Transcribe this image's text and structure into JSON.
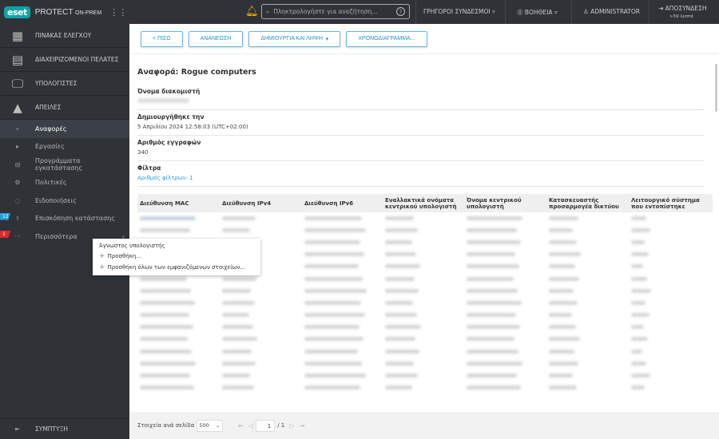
{
  "header": {
    "logo": "eset",
    "product": "PROTECT",
    "product_suffix": "ON-PREM",
    "search_placeholder": "Πληκτρολογήστε για αναζήτηση...",
    "quick_links": "ΓΡΗΓΟΡΟΙ ΣΥΝΔΕΣΜΟΙ",
    "help": "ΒΟΗΘΕΙΑ",
    "user": "ADMINISTRATOR",
    "logout": "ΑΠΟΣΥΝΔΕΣΗ",
    "logout_time": ">59 λεπτά"
  },
  "sidebar": {
    "main_items": [
      {
        "label": "ΠΙΝΑΚΑΣ ΕΛΕΓΧΟΥ",
        "icon": "dashboard-icon"
      },
      {
        "label": "ΔΙΑΧΕΙΡΙΖΟΜΕΝΟΙ ΠΕΛΑΤΕΣ",
        "icon": "building-icon"
      },
      {
        "label": "ΥΠΟΛΟΓΙΣΤΕΣ",
        "icon": "computers-icon"
      },
      {
        "label": "ΑΠΕΙΛΕΣ",
        "icon": "warning-icon"
      }
    ],
    "sub_items": [
      {
        "label": "Αναφορές",
        "icon": "reports-icon",
        "active": true
      },
      {
        "label": "Εργασίες",
        "icon": "tasks-icon"
      },
      {
        "label": "Προγράμματα εγκατάστασης",
        "icon": "installers-icon"
      },
      {
        "label": "Πολιτικές",
        "icon": "policies-icon"
      },
      {
        "label": "Ειδοποιήσεις",
        "icon": "notifications-icon"
      },
      {
        "label": "Επισκόπηση κατάστασης",
        "icon": "status-icon",
        "badge": "12",
        "badge_color": "#2a9fd6"
      },
      {
        "label": "Περισσότερα",
        "icon": "more-icon",
        "badge": "1",
        "badge_color": "#d92b2b"
      }
    ],
    "collapse": "ΣΥΜΠΤΥΞΗ"
  },
  "toolbar": {
    "back": "< ΠΙΣΩ",
    "refresh": "ΑΝΑΝΕΩΣΗ",
    "generate": "ΔΗΜΙΟΥΡΓΙΑ ΚΑΙ ΛΗΨΗ",
    "schedule": "ΧΡΟΝΟΔΙΑΓΡΑΜΜΑ..."
  },
  "report": {
    "title": "Αναφορά: Rogue computers",
    "server_label": "Όνομα διακομιστή",
    "created_label": "Δημιουργήθηκε την",
    "created_value": "5 Απριλίου 2024 12:58:03 (UTC+02:00)",
    "count_label": "Αριθμός εγγραφών",
    "count_value": "340",
    "filters_label": "Φίλτρα",
    "filters_link": "Αριθμός φίλτρων: 1"
  },
  "table": {
    "columns": [
      "Διεύθυνση MAC",
      "Διεύθυνση IPv4",
      "Διεύθυνση IPv6",
      "Εναλλακτικά ονόματα κεντρικού υπολογιστή",
      "Όνομα κεντρικού υπολογιστή",
      "Κατασκευαστής προσαρμογέα δικτύου",
      "Λειτουργικό σύστημα που εντοπίστηκε"
    ]
  },
  "context_menu": {
    "title": "Άγνωστος υπολογιστής",
    "add": "Προσθήκη...",
    "add_all": "Προσθήκη όλων των εμφανιζόμενων στοιχείων..."
  },
  "footer": {
    "per_page_label": "Στοιχεία ανά σελίδα",
    "per_page": "500",
    "page": "1",
    "total_pages": "/ 1"
  },
  "colors": {
    "accent": "#2a9fd6",
    "sidebar": "#2f3338",
    "brand": "#0fa3a8"
  }
}
